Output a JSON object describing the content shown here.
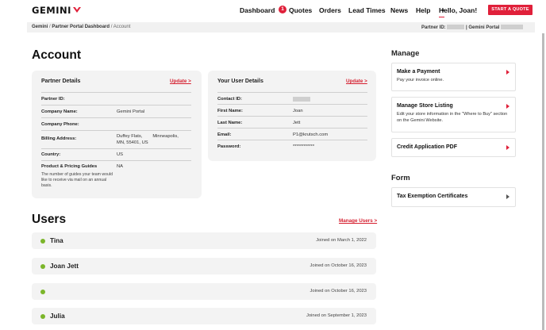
{
  "nav": {
    "logo": "GEMINI",
    "links": [
      "Dashboard",
      "Quotes",
      "Orders",
      "Lead Times",
      "News",
      "Help"
    ],
    "quotes_badge": "1",
    "hello": "Hello, Joan!",
    "cta": "START A QUOTE"
  },
  "breadcrumb": {
    "items": [
      "Gemini",
      "Partner Portal Dashboard",
      "Account"
    ],
    "separator": "/",
    "partner_id_label": "Partner ID:",
    "partner_suffix": "| Gemini Portal"
  },
  "account": {
    "title": "Account",
    "partner_details": {
      "title": "Partner Details",
      "update": "Update >",
      "rows": [
        {
          "label": "Partner ID:",
          "value": ""
        },
        {
          "label": "Company Name:",
          "value": "Gemini Portal"
        },
        {
          "label": "Company Phone:",
          "value": ""
        },
        {
          "label": "Billing Address:",
          "value": "Duffey Flats,        Minneapolis,\nMN, 55401, US"
        },
        {
          "label": "Country:",
          "value": "US"
        },
        {
          "label": "Product & Pricing Guides",
          "value": "NA"
        }
      ],
      "note": "The number of guides your team would like to receive via mail on an annual basis."
    },
    "user_details": {
      "title": "Your User Details",
      "update": "Update >",
      "rows": [
        {
          "label": "Contact ID:",
          "value": ""
        },
        {
          "label": "First Name:",
          "value": "Joan"
        },
        {
          "label": "Last Name:",
          "value": "Jett"
        },
        {
          "label": "Email:",
          "value": "P1@krutsch.com"
        },
        {
          "label": "Password:",
          "value": "************"
        }
      ]
    }
  },
  "manage": {
    "title": "Manage",
    "cards": [
      {
        "title": "Make a Payment",
        "desc": "Pay your invoice online."
      },
      {
        "title": "Manage Store Listing",
        "desc": "Edit your store information in the \"Where to Buy\" section on the Gemini Website."
      },
      {
        "title": "Credit Application PDF",
        "desc": ""
      }
    ]
  },
  "form": {
    "title": "Form",
    "cards": [
      {
        "title": "Tax Exemption Certificates"
      }
    ]
  },
  "users": {
    "title": "Users",
    "manage_link": "Manage Users >",
    "list": [
      {
        "name": "Tina",
        "joined": "Joined on March 1, 2022"
      },
      {
        "name": "Joan Jett",
        "joined": "Joined on October 16, 2023"
      },
      {
        "name": "",
        "joined": "Joined on October 16, 2023"
      },
      {
        "name": "Julia",
        "joined": "Joined on September 1, 2023"
      }
    ]
  },
  "colors": {
    "accent": "#e0203a",
    "status_active": "#7bb52a",
    "card_bg": "#f3f3f3"
  }
}
